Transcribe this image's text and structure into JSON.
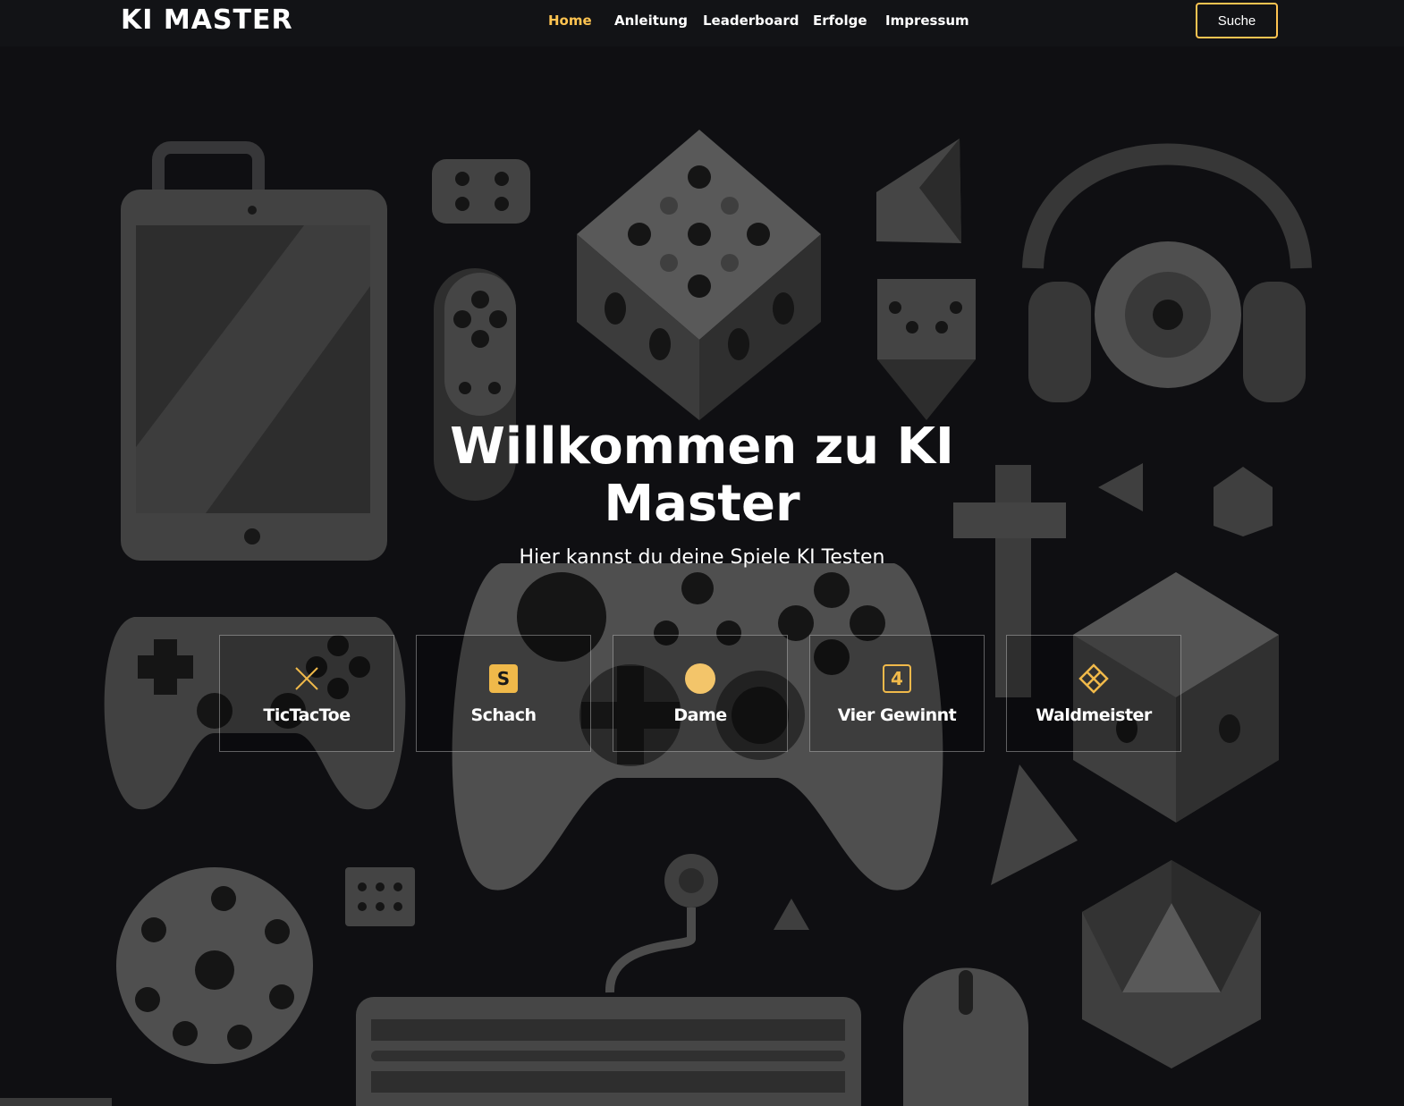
{
  "header": {
    "logo": "KI MASTER",
    "nav": [
      {
        "label": "Home",
        "active": true
      },
      {
        "label": "Anleitung",
        "active": false
      },
      {
        "label": "Leaderboard",
        "active": false
      },
      {
        "label": "Erfolge",
        "active": false
      },
      {
        "label": "Impressum",
        "active": false
      }
    ],
    "search_label": "Suche"
  },
  "hero": {
    "title": "Willkommen zu KI Master",
    "subtitle": "Hier kannst du deine Spiele KI Testen"
  },
  "games": [
    {
      "label": "TicTacToe",
      "icon": "x-icon"
    },
    {
      "label": "Schach",
      "icon": "s-badge-icon",
      "icon_text": "S"
    },
    {
      "label": "Dame",
      "icon": "circle-icon"
    },
    {
      "label": "Vier Gewinnt",
      "icon": "number-4-icon",
      "icon_text": "4"
    },
    {
      "label": "Waldmeister",
      "icon": "diamond-grid-icon"
    }
  ],
  "colors": {
    "accent": "#ffc451",
    "icon_gold": "#f0b94a",
    "background": "#121316",
    "text": "#ffffff"
  }
}
